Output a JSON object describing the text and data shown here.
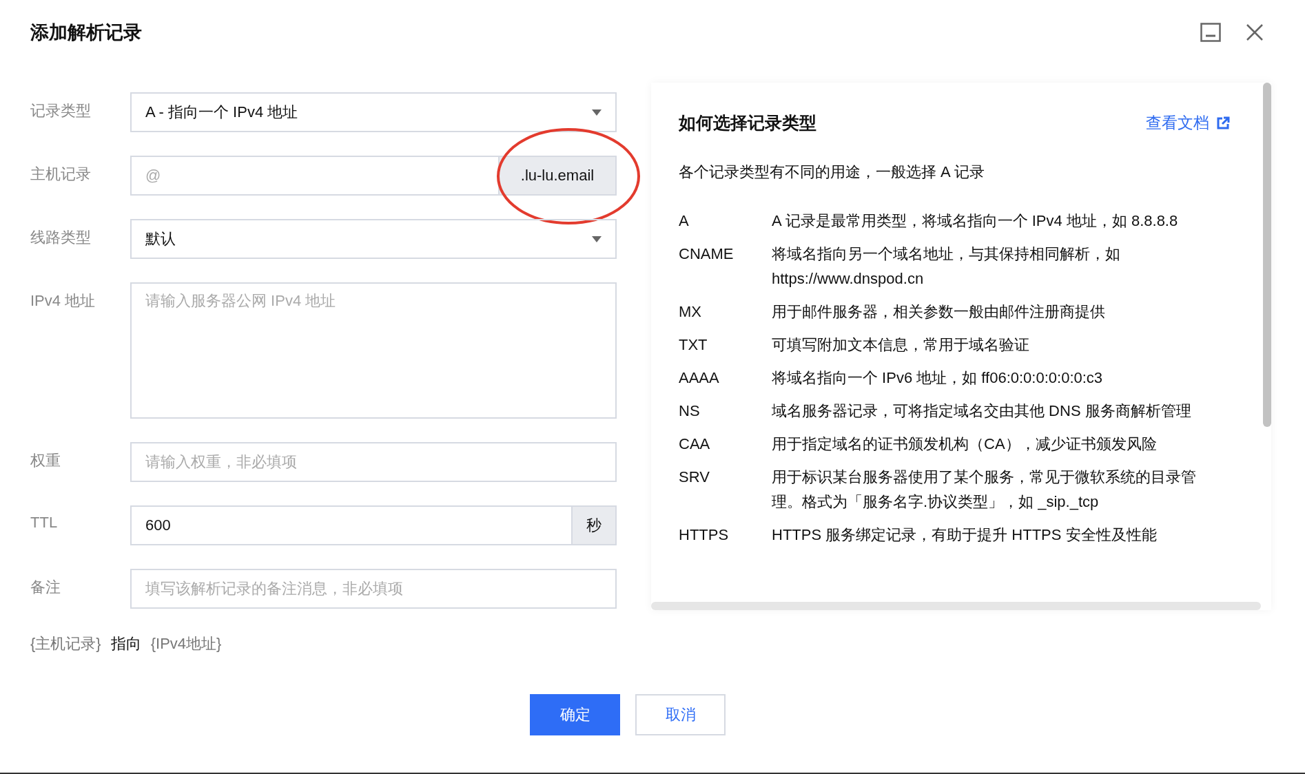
{
  "dialog": {
    "title": "添加解析记录"
  },
  "form": {
    "fields": [
      {
        "kind": "select",
        "label": "记录类型",
        "value": "A - 指向一个 IPv4 地址"
      },
      {
        "kind": "suffix",
        "label": "主机记录",
        "placeholder": "@",
        "suffix": ".lu-lu.email",
        "highlighted": true
      },
      {
        "kind": "select",
        "label": "线路类型",
        "value": "默认"
      },
      {
        "kind": "textarea",
        "label": "IPv4 地址",
        "placeholder": "请输入服务器公网 IPv4 地址"
      },
      {
        "kind": "input",
        "label": "权重",
        "placeholder": "请输入权重，非必填项"
      },
      {
        "kind": "unit",
        "label": "TTL",
        "value": "600",
        "unit": "秒"
      },
      {
        "kind": "input",
        "label": "备注",
        "placeholder": "填写该解析记录的备注消息，非必填项"
      }
    ],
    "summary": [
      {
        "kind": "token",
        "text": "{主机记录}"
      },
      {
        "kind": "plain",
        "text": "指向"
      },
      {
        "kind": "token",
        "text": "{IPv4地址}"
      }
    ]
  },
  "help": {
    "title": "如何选择记录类型",
    "link": "查看文档",
    "intro": "各个记录类型有不同的用途，一般选择 A 记录",
    "rows": [
      {
        "type": "A",
        "description": "A 记录是最常用类型，将域名指向一个 IPv4 地址，如 8.8.8.8"
      },
      {
        "type": "CNAME",
        "description": "将域名指向另一个域名地址，与其保持相同解析，如 https://www.dnspod.cn"
      },
      {
        "type": "MX",
        "description": "用于邮件服务器，相关参数一般由邮件注册商提供"
      },
      {
        "type": "TXT",
        "description": "可填写附加文本信息，常用于域名验证"
      },
      {
        "type": "AAAA",
        "description": "将域名指向一个 IPv6 地址，如 ff06:0:0:0:0:0:0:c3"
      },
      {
        "type": "NS",
        "description": "域名服务器记录，可将指定域名交由其他 DNS 服务商解析管理"
      },
      {
        "type": "CAA",
        "description": "用于指定域名的证书颁发机构（CA），减少证书颁发风险"
      },
      {
        "type": "SRV",
        "description": "用于标识某台服务器使用了某个服务，常见于微软系统的目录管理。格式为「服务名字.协议类型」，如 _sip._tcp"
      },
      {
        "type": "HTTPS",
        "description": "HTTPS 服务绑定记录，有助于提升 HTTPS 安全性及性能"
      }
    ]
  },
  "buttons": [
    {
      "kind": "primary",
      "label": "确定"
    },
    {
      "kind": "secondary",
      "label": "取消"
    }
  ]
}
